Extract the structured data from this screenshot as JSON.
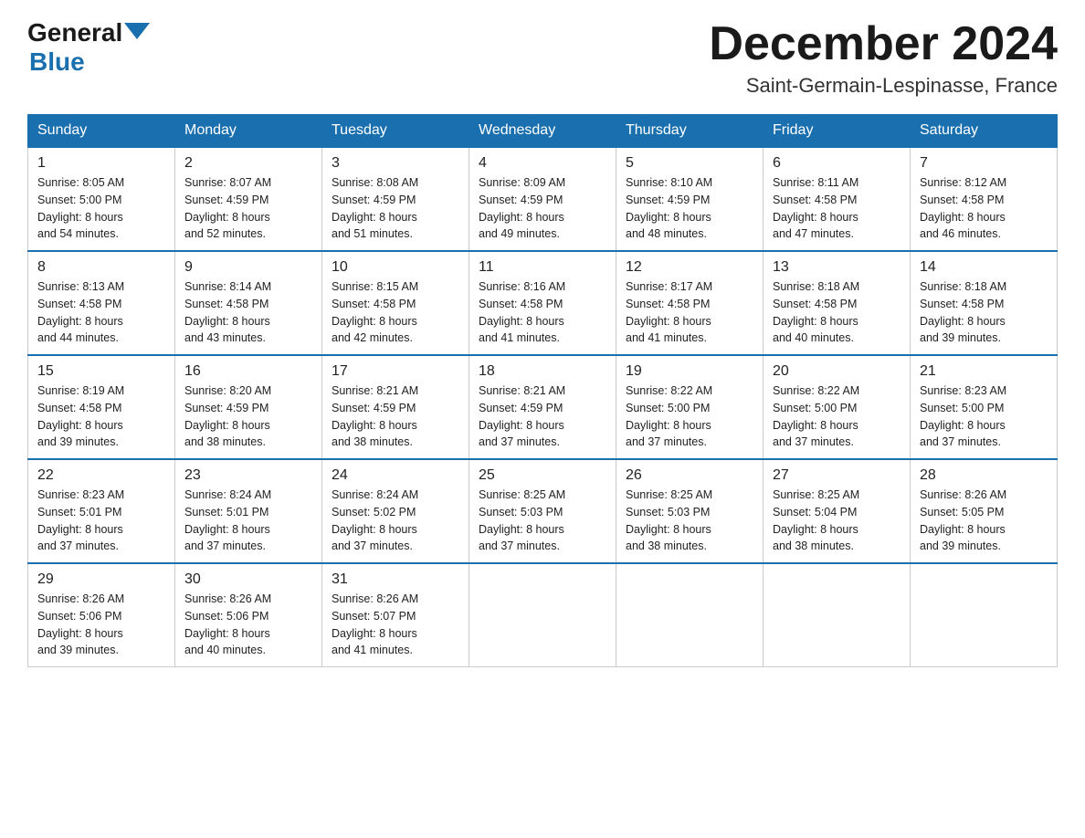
{
  "header": {
    "logo_general": "General",
    "logo_blue": "Blue",
    "month_title": "December 2024",
    "location": "Saint-Germain-Lespinasse, France"
  },
  "weekdays": [
    "Sunday",
    "Monday",
    "Tuesday",
    "Wednesday",
    "Thursday",
    "Friday",
    "Saturday"
  ],
  "weeks": [
    [
      {
        "day": "1",
        "sunrise": "8:05 AM",
        "sunset": "5:00 PM",
        "daylight": "8 hours and 54 minutes."
      },
      {
        "day": "2",
        "sunrise": "8:07 AM",
        "sunset": "4:59 PM",
        "daylight": "8 hours and 52 minutes."
      },
      {
        "day": "3",
        "sunrise": "8:08 AM",
        "sunset": "4:59 PM",
        "daylight": "8 hours and 51 minutes."
      },
      {
        "day": "4",
        "sunrise": "8:09 AM",
        "sunset": "4:59 PM",
        "daylight": "8 hours and 49 minutes."
      },
      {
        "day": "5",
        "sunrise": "8:10 AM",
        "sunset": "4:59 PM",
        "daylight": "8 hours and 48 minutes."
      },
      {
        "day": "6",
        "sunrise": "8:11 AM",
        "sunset": "4:58 PM",
        "daylight": "8 hours and 47 minutes."
      },
      {
        "day": "7",
        "sunrise": "8:12 AM",
        "sunset": "4:58 PM",
        "daylight": "8 hours and 46 minutes."
      }
    ],
    [
      {
        "day": "8",
        "sunrise": "8:13 AM",
        "sunset": "4:58 PM",
        "daylight": "8 hours and 44 minutes."
      },
      {
        "day": "9",
        "sunrise": "8:14 AM",
        "sunset": "4:58 PM",
        "daylight": "8 hours and 43 minutes."
      },
      {
        "day": "10",
        "sunrise": "8:15 AM",
        "sunset": "4:58 PM",
        "daylight": "8 hours and 42 minutes."
      },
      {
        "day": "11",
        "sunrise": "8:16 AM",
        "sunset": "4:58 PM",
        "daylight": "8 hours and 41 minutes."
      },
      {
        "day": "12",
        "sunrise": "8:17 AM",
        "sunset": "4:58 PM",
        "daylight": "8 hours and 41 minutes."
      },
      {
        "day": "13",
        "sunrise": "8:18 AM",
        "sunset": "4:58 PM",
        "daylight": "8 hours and 40 minutes."
      },
      {
        "day": "14",
        "sunrise": "8:18 AM",
        "sunset": "4:58 PM",
        "daylight": "8 hours and 39 minutes."
      }
    ],
    [
      {
        "day": "15",
        "sunrise": "8:19 AM",
        "sunset": "4:58 PM",
        "daylight": "8 hours and 39 minutes."
      },
      {
        "day": "16",
        "sunrise": "8:20 AM",
        "sunset": "4:59 PM",
        "daylight": "8 hours and 38 minutes."
      },
      {
        "day": "17",
        "sunrise": "8:21 AM",
        "sunset": "4:59 PM",
        "daylight": "8 hours and 38 minutes."
      },
      {
        "day": "18",
        "sunrise": "8:21 AM",
        "sunset": "4:59 PM",
        "daylight": "8 hours and 37 minutes."
      },
      {
        "day": "19",
        "sunrise": "8:22 AM",
        "sunset": "5:00 PM",
        "daylight": "8 hours and 37 minutes."
      },
      {
        "day": "20",
        "sunrise": "8:22 AM",
        "sunset": "5:00 PM",
        "daylight": "8 hours and 37 minutes."
      },
      {
        "day": "21",
        "sunrise": "8:23 AM",
        "sunset": "5:00 PM",
        "daylight": "8 hours and 37 minutes."
      }
    ],
    [
      {
        "day": "22",
        "sunrise": "8:23 AM",
        "sunset": "5:01 PM",
        "daylight": "8 hours and 37 minutes."
      },
      {
        "day": "23",
        "sunrise": "8:24 AM",
        "sunset": "5:01 PM",
        "daylight": "8 hours and 37 minutes."
      },
      {
        "day": "24",
        "sunrise": "8:24 AM",
        "sunset": "5:02 PM",
        "daylight": "8 hours and 37 minutes."
      },
      {
        "day": "25",
        "sunrise": "8:25 AM",
        "sunset": "5:03 PM",
        "daylight": "8 hours and 37 minutes."
      },
      {
        "day": "26",
        "sunrise": "8:25 AM",
        "sunset": "5:03 PM",
        "daylight": "8 hours and 38 minutes."
      },
      {
        "day": "27",
        "sunrise": "8:25 AM",
        "sunset": "5:04 PM",
        "daylight": "8 hours and 38 minutes."
      },
      {
        "day": "28",
        "sunrise": "8:26 AM",
        "sunset": "5:05 PM",
        "daylight": "8 hours and 39 minutes."
      }
    ],
    [
      {
        "day": "29",
        "sunrise": "8:26 AM",
        "sunset": "5:06 PM",
        "daylight": "8 hours and 39 minutes."
      },
      {
        "day": "30",
        "sunrise": "8:26 AM",
        "sunset": "5:06 PM",
        "daylight": "8 hours and 40 minutes."
      },
      {
        "day": "31",
        "sunrise": "8:26 AM",
        "sunset": "5:07 PM",
        "daylight": "8 hours and 41 minutes."
      },
      null,
      null,
      null,
      null
    ]
  ],
  "labels": {
    "sunrise": "Sunrise:",
    "sunset": "Sunset:",
    "daylight": "Daylight:"
  }
}
